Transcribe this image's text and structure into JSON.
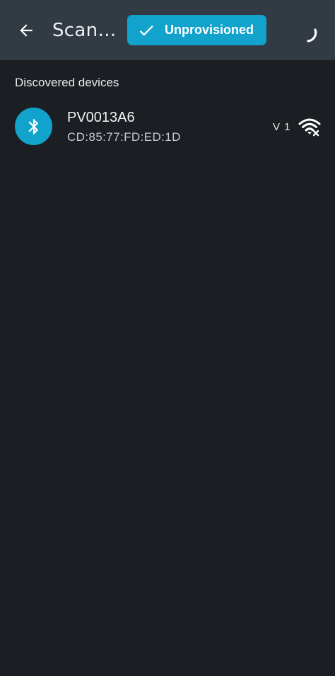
{
  "appbar": {
    "title": "Scan…",
    "filter_chip_label": "Unprovisioned",
    "accent": "#11a3cc",
    "background": "#323b43"
  },
  "section": {
    "header": "Discovered devices"
  },
  "devices": [
    {
      "name": "PV0013A6",
      "address": "CD:85:77:FD:ED:1D",
      "version": "V 1",
      "icon": "bluetooth-icon",
      "status_icon": "wifi-off-icon"
    }
  ]
}
